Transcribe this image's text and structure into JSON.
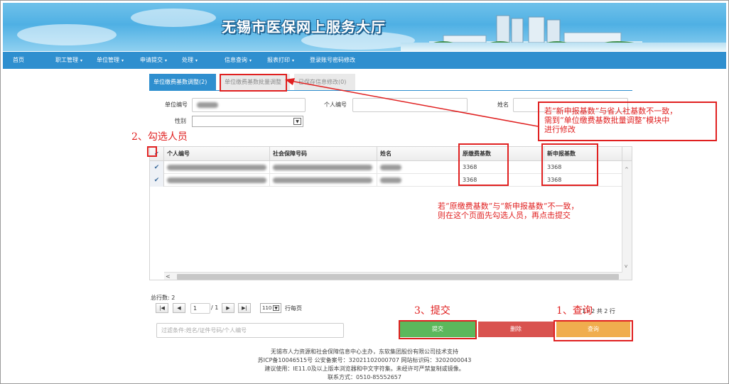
{
  "banner": {
    "title": "无锡市医保网上服务大厅"
  },
  "nav": {
    "items": [
      {
        "label": "首页",
        "caret": ""
      },
      {
        "label": "职工管理",
        "caret": "▾"
      },
      {
        "label": "单位管理",
        "caret": "▾"
      },
      {
        "label": "申请提交",
        "caret": "▾"
      },
      {
        "label": "处理",
        "caret": "▾"
      },
      {
        "label": "信息查询",
        "caret": "▾"
      },
      {
        "label": "报表打印",
        "caret": "▾"
      },
      {
        "label": "登录账号密码修改",
        "caret": ""
      }
    ]
  },
  "tabs": [
    {
      "label": "单位缴费基数调整(2)",
      "active": true
    },
    {
      "label": "单位缴费基数批量调整",
      "active": false
    },
    {
      "label": "已保存信息修改(0)",
      "active": false
    }
  ],
  "form": {
    "unit_no_label": "单位编号",
    "person_no_label": "个人编号",
    "name_label": "姓名",
    "gender_label": "性别",
    "person_no_value": "",
    "name_value": ""
  },
  "grid": {
    "columns": [
      "个人编号",
      "社会保障号码",
      "姓名",
      "原缴费基数",
      "新申报基数"
    ],
    "header_check": "✔",
    "rows": [
      {
        "check": "✔",
        "orig_base": "3368",
        "new_base": "3368"
      },
      {
        "check": "✔",
        "orig_base": "3368",
        "new_base": "3368"
      }
    ]
  },
  "pager": {
    "total_label": "总行数:",
    "total": "2",
    "first": "|◀",
    "prev": "◀",
    "page": "1",
    "of": "/ 1",
    "next": "▶",
    "last": "▶|",
    "page_size": "110",
    "per_page": "行每页",
    "summary": "1 - 2 共 2 行"
  },
  "actions": {
    "filter_placeholder": "过滤条件:姓名/证件号码/个人编号",
    "submit": "提交",
    "delete": "删除",
    "query": "查询"
  },
  "footer": {
    "line1": "无锡市人力资源和社会保障信息中心主办，东软集团股份有限公司技术支持",
    "line2": "苏ICP备10046515号   公安备案号：32021102000707    网站标识码：3202000043",
    "line3": "建议使用：IE11.0及以上版本浏览器和中文字符集。未经许可严禁复制或镜像。",
    "line4": "联系方式：0510-85552657"
  },
  "annotations": {
    "step1": "1、查询",
    "step2": "2、勾选人员",
    "step3": "3、提交",
    "note_batch": [
      "若“新申报基数”与省人社基数不一致，",
      "需到“单位缴费基数批量调整”模块中",
      "进行修改"
    ],
    "note_submit": [
      "若“原缴费基数”与“新申报基数”不一致，",
      "则在这个页面先勾选人员，再点击提交"
    ]
  },
  "colors": {
    "nav": "#2f8fcf",
    "submit": "#5cb85c",
    "delete": "#d9534f",
    "query": "#f0ad4e",
    "annotation": "#e02020"
  }
}
